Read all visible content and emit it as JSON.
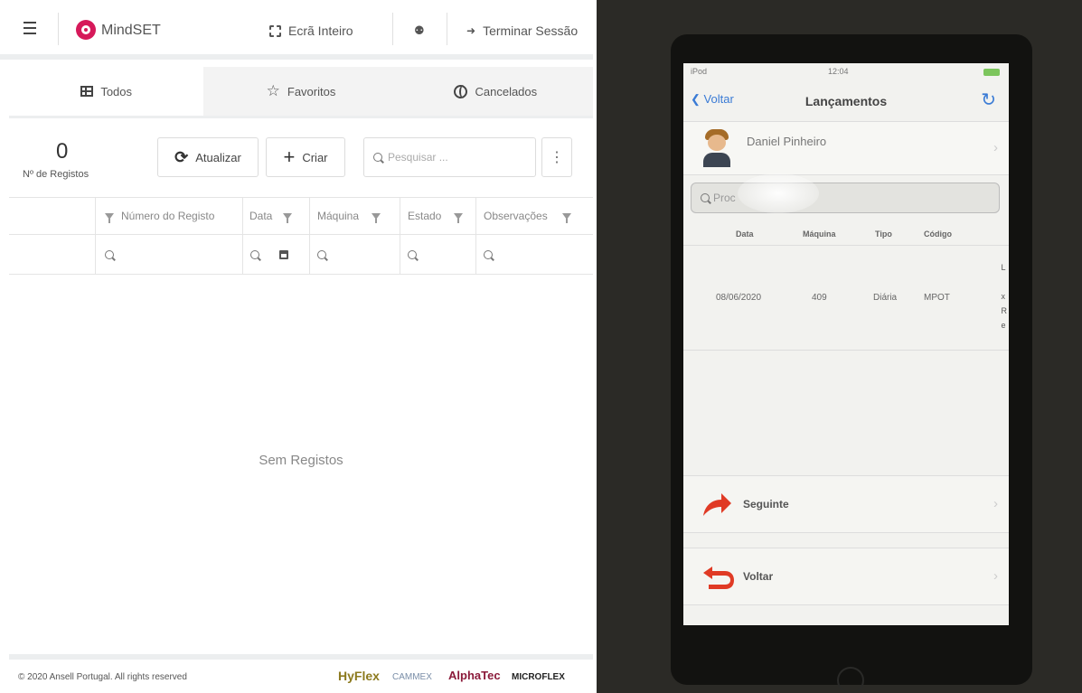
{
  "app": {
    "brand": "MindSET",
    "fullscreen_label": "Ecrã Inteiro",
    "logout_label": "Terminar Sessão"
  },
  "tabs": [
    {
      "label": "Todos",
      "icon": "grid-icon",
      "active": true
    },
    {
      "label": "Favoritos",
      "icon": "star-icon",
      "active": false
    },
    {
      "label": "Cancelados",
      "icon": "cancel-circle-icon",
      "active": false
    }
  ],
  "toolbar": {
    "count": "0",
    "count_label": "Nº de Registos",
    "refresh_label": "Atualizar",
    "create_label": "Criar",
    "search_placeholder": "Pesquisar ...",
    "more_label": "⋮"
  },
  "grid": {
    "columns": [
      "Número do Registo",
      "Data",
      "Máquina",
      "Estado",
      "Observações"
    ],
    "empty_text": "Sem Registos"
  },
  "footer": {
    "copyright": "© 2020 Ansell Portugal. All rights reserved",
    "brands": [
      {
        "name": "HyFlex",
        "color": "#8c7a1e"
      },
      {
        "name": "CAMMEX",
        "color": "#7a8ea8"
      },
      {
        "name": "AlphaTec",
        "color": "#8b1a3a"
      },
      {
        "name": "MICROFLEX",
        "color": "#222222"
      }
    ]
  },
  "phone": {
    "status": {
      "left": "iPod",
      "center": "12:04"
    },
    "nav": {
      "back": "Voltar",
      "title": "Lançamentos"
    },
    "user": {
      "name": "Daniel Pinheiro"
    },
    "search_placeholder": "Proc",
    "table": {
      "headers": [
        "Data",
        "Máquina",
        "Tipo",
        "Código"
      ],
      "row": {
        "data": "08/06/2020",
        "maquina": "409",
        "tipo": "Diária",
        "codigo": "MPOT"
      }
    },
    "actions": {
      "next": "Seguinte",
      "back": "Voltar"
    }
  },
  "colors": {
    "accent": "#d6195a",
    "ios_blue": "#3a7bd5",
    "arrow_red": "#e03a25"
  }
}
